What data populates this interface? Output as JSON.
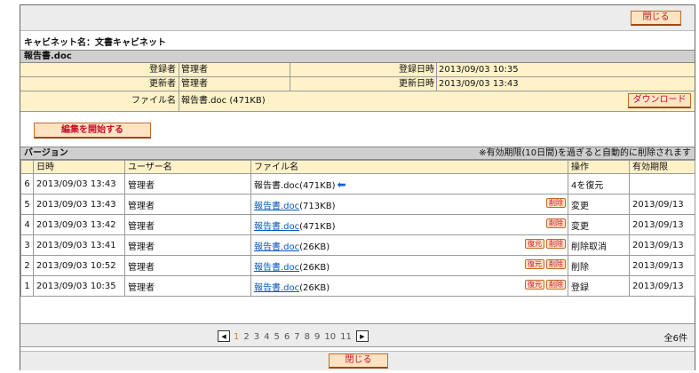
{
  "top": {
    "close_label": "閉じる"
  },
  "cabinet_label": "キャビネット名：文書キャビネット",
  "info": {
    "title": "報告書.doc",
    "registered_by_label": "登録者",
    "registered_by": "管理者",
    "registered_at_label": "登録日時",
    "registered_at": "2013/09/03 10:35",
    "updated_by_label": "更新者",
    "updated_by": "管理者",
    "updated_at_label": "更新日時",
    "updated_at": "2013/09/03 13:43",
    "file_label": "ファイル名",
    "file_name": "報告書.doc (471KB)",
    "download_label": "ダウンロード"
  },
  "edit_label": "編集を開始する",
  "versions": {
    "title": "バージョン",
    "note": "※有効期限(10日間)を過ぎると自動的に削除されます",
    "columns": [
      "日時",
      "ユーザー名",
      "ファイル名",
      "操作",
      "有効期限"
    ],
    "restore_label": "復元",
    "delete_label": "削除",
    "rows": [
      {
        "num": "6",
        "datetime": "2013/09/03 13:43",
        "user": "管理者",
        "file": "報告書.doc",
        "size": "(471KB)",
        "op": "4を復元",
        "expiry": ""
      },
      {
        "num": "5",
        "datetime": "2013/09/03 13:43",
        "user": "管理者",
        "file": "報告書.doc",
        "size": "(713KB)",
        "op": "変更",
        "expiry": "2013/09/13"
      },
      {
        "num": "4",
        "datetime": "2013/09/03 13:42",
        "user": "管理者",
        "file": "報告書.doc",
        "size": "(471KB)",
        "op": "変更",
        "expiry": "2013/09/13"
      },
      {
        "num": "3",
        "datetime": "2013/09/03 13:41",
        "user": "管理者",
        "file": "報告書.doc",
        "size": "(26KB)",
        "op": "削除取消",
        "expiry": "2013/09/13"
      },
      {
        "num": "2",
        "datetime": "2013/09/03 10:52",
        "user": "管理者",
        "file": "報告書.doc",
        "size": "(26KB)",
        "op": "削除",
        "expiry": "2013/09/13"
      },
      {
        "num": "1",
        "datetime": "2013/09/03 10:35",
        "user": "管理者",
        "file": "報告書.doc",
        "size": "(26KB)",
        "op": "登録",
        "expiry": "2013/09/13"
      }
    ]
  },
  "pager": {
    "pages": [
      "1",
      "2",
      "3",
      "4",
      "5",
      "6",
      "7",
      "8",
      "9",
      "10",
      "11"
    ],
    "current": "1",
    "total": "全6件",
    "prev_icon": "triangle-left-icon",
    "next_icon": "triangle-right-icon"
  },
  "bottom": {
    "close_label": "閉じる"
  }
}
